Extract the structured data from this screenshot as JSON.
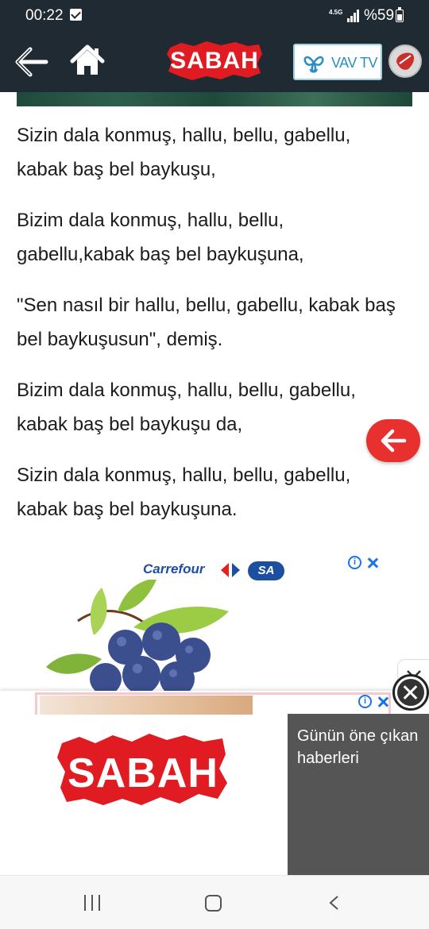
{
  "status_bar": {
    "time": "00:22",
    "network": "4.5G",
    "battery": "%59"
  },
  "header": {
    "logo": "SABAH",
    "vav_tv": "VAV TV",
    "colors": {
      "header_bg": "#1f2a33",
      "brand_red": "#e01b22"
    }
  },
  "article": {
    "paragraphs": [
      "Sizin dala konmuş, hallu, bellu, gabellu, kabak baş bel baykuşu,",
      "Bizim dala konmuş, hallu, bellu, gabellu,kabak baş bel baykuşuna,",
      "\"Sen nasıl bir hallu, bellu, gabellu, kabak baş bel baykuşusun\", demiş.",
      "Bizim dala konmuş, hallu, bellu, gabellu, kabak baş bel baykuşu da,",
      "Sizin dala konmuş, hallu, bellu, gabellu, kabak baş bel baykuşuna."
    ]
  },
  "ad_carrefour": {
    "brand": "Carrefour",
    "badge": "SA",
    "info_icon": "i"
  },
  "ad_bottom": {
    "logo": "SABAH",
    "panel_text": "Günün öne çıkan haberleri",
    "info_icon": "i"
  }
}
